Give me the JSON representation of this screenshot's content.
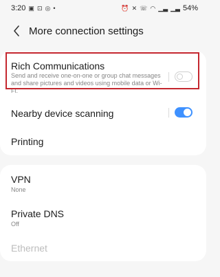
{
  "status_bar": {
    "time": "3:20",
    "battery": "54%",
    "left_icons": [
      "sim-icon",
      "email-icon",
      "message-icon",
      "dot-icon"
    ],
    "right_icons": [
      "alarm-icon",
      "mute-icon",
      "wifi-call-icon",
      "wifi-icon",
      "signal-icon",
      "signal-icon",
      "battery-icon"
    ]
  },
  "header": {
    "title": "More connection settings"
  },
  "sections": {
    "rich": {
      "title": "Rich Communications",
      "description": "Send and receive one-on-one or group chat messages and share pictures and videos using mobile data or Wi-Fi.",
      "enabled": false
    },
    "nearby": {
      "title": "Nearby device scanning",
      "enabled": true
    },
    "printing": {
      "title": "Printing"
    },
    "vpn": {
      "title": "VPN",
      "value": "None"
    },
    "private_dns": {
      "title": "Private DNS",
      "value": "Off"
    },
    "ethernet": {
      "title": "Ethernet"
    }
  },
  "colors": {
    "accent": "#3e91ff",
    "highlight": "#c4262e",
    "background": "#f6f6f6"
  }
}
